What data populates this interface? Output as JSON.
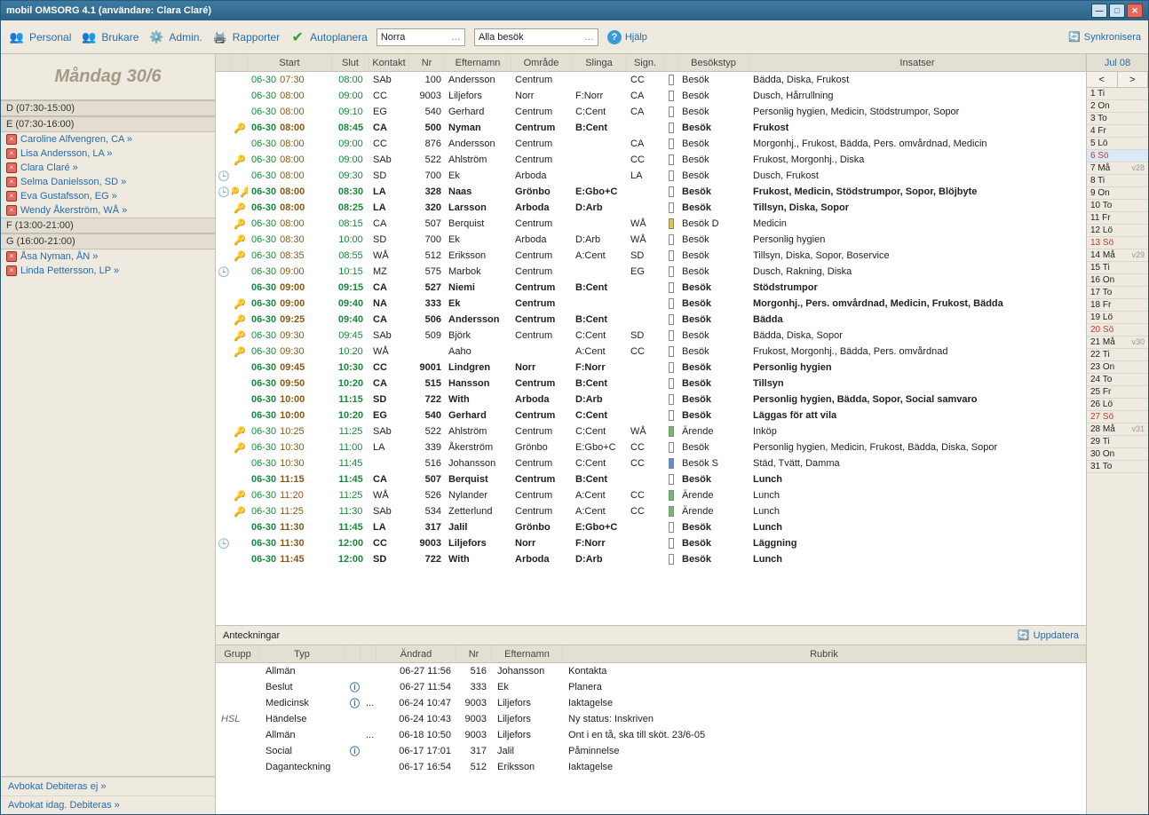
{
  "window": {
    "title": "mobil OMSORG 4.1 (användare: Clara Claré)"
  },
  "toolbar": {
    "personal": "Personal",
    "brukare": "Brukare",
    "admin": "Admin.",
    "rapporter": "Rapporter",
    "autoplanera": "Autoplanera",
    "combo1": "Norra",
    "combo2": "Alla besök",
    "help": "Hjälp",
    "sync": "Synkronisera"
  },
  "sidebar": {
    "day": "Måndag 30/6",
    "groups": [
      {
        "label": "D (07:30-15:00)",
        "staff": []
      },
      {
        "label": "E (07:30-16:00)",
        "staff": [
          "Caroline Alfvengren, CA »",
          "Lisa Andersson, LA »",
          "Clara Claré »",
          "Selma Danielsson, SD »",
          "Eva Gustafsson, EG »",
          "Wendy Åkerström, WÅ »"
        ]
      },
      {
        "label": "F (13:00-21:00)",
        "staff": []
      },
      {
        "label": "G (16:00-21:00)",
        "staff": [
          "Åsa Nyman, ÅN »",
          "Linda  Pettersson, LP »"
        ]
      }
    ],
    "foot1": "Avbokat Debiteras ej »",
    "foot2": "Avbokat idag. Debiteras »"
  },
  "grid": {
    "headers": {
      "start": "Start",
      "slut": "Slut",
      "kontakt": "Kontakt",
      "nr": "Nr",
      "efternamn": "Efternamn",
      "omrade": "Område",
      "slinga": "Slinga",
      "sign": "Sign.",
      "besokstyp": "Besökstyp",
      "insatser": "Insatser"
    },
    "rows": [
      {
        "k": 0,
        "cl": 0,
        "bold": 0,
        "date": "06-30",
        "st": "07:30",
        "sl": "08:00",
        "ko": "SAb",
        "nr": "100",
        "en": "Andersson",
        "om": "Centrum",
        "sli": "",
        "si": "CC",
        "bar": "",
        "ty": "Besök",
        "ins": "Bädda, Diska, Frukost"
      },
      {
        "k": 0,
        "cl": 0,
        "bold": 0,
        "date": "06-30",
        "st": "08:00",
        "sl": "09:00",
        "ko": "CC",
        "nr": "9003",
        "en": "Liljefors",
        "om": "Norr",
        "sli": "F:Norr",
        "si": "CA",
        "bar": "",
        "ty": "Besök",
        "ins": "Dusch, Hårrullning"
      },
      {
        "k": 0,
        "cl": 0,
        "bold": 0,
        "date": "06-30",
        "st": "08:00",
        "sl": "09:10",
        "ko": "EG",
        "nr": "540",
        "en": "Gerhard",
        "om": "Centrum",
        "sli": "C:Cent",
        "si": "CA",
        "bar": "",
        "ty": "Besök",
        "ins": "Personlig hygien, Medicin, Stödstrumpor, Sopor"
      },
      {
        "k": 1,
        "cl": 0,
        "bold": 1,
        "date": "06-30",
        "st": "08:00",
        "sl": "08:45",
        "ko": "CA",
        "nr": "500",
        "en": "Nyman",
        "om": "Centrum",
        "sli": "B:Cent",
        "si": "",
        "bar": "",
        "ty": "Besök",
        "ins": "Frukost"
      },
      {
        "k": 0,
        "cl": 0,
        "bold": 0,
        "date": "06-30",
        "st": "08:00",
        "sl": "09:00",
        "ko": "CC",
        "nr": "876",
        "en": "Andersson",
        "om": "Centrum",
        "sli": "",
        "si": "CA",
        "bar": "",
        "ty": "Besök",
        "ins": "Morgonhj., Frukost, Bädda, Pers. omvårdnad, Medicin"
      },
      {
        "k": 1,
        "cl": 0,
        "bold": 0,
        "date": "06-30",
        "st": "08:00",
        "sl": "09:00",
        "ko": "SAb",
        "nr": "522",
        "en": "Ahlström",
        "om": "Centrum",
        "sli": "",
        "si": "CC",
        "bar": "",
        "ty": "Besök",
        "ins": "Frukost, Morgonhj., Diska"
      },
      {
        "k": 0,
        "cl": 1,
        "bold": 0,
        "date": "06-30",
        "st": "08:00",
        "sl": "09:30",
        "ko": "SD",
        "nr": "700",
        "en": "Ek",
        "om": "Arboda",
        "sli": "",
        "si": "LA",
        "bar": "",
        "ty": "Besök",
        "ins": "Dusch, Frukost"
      },
      {
        "k": 2,
        "cl": 1,
        "bold": 1,
        "date": "06-30",
        "st": "08:00",
        "sl": "08:30",
        "ko": "LA",
        "nr": "328",
        "en": "Naas",
        "om": "Grönbo",
        "sli": "E:Gbo+C",
        "si": "",
        "bar": "",
        "ty": "Besök",
        "ins": "Frukost, Medicin, Stödstrumpor, Sopor, Blöjbyte"
      },
      {
        "k": 1,
        "cl": 0,
        "bold": 1,
        "date": "06-30",
        "st": "08:00",
        "sl": "08:25",
        "ko": "LA",
        "nr": "320",
        "en": "Larsson",
        "om": "Arboda",
        "sli": "D:Arb",
        "si": "",
        "bar": "",
        "ty": "Besök",
        "ins": "Tillsyn, Diska, Sopor"
      },
      {
        "k": 1,
        "cl": 0,
        "bold": 0,
        "date": "06-30",
        "st": "08:00",
        "sl": "08:15",
        "ko": "CA",
        "nr": "507",
        "en": "Berquist",
        "om": "Centrum",
        "sli": "",
        "si": "WÅ",
        "bar": "y",
        "ty": "Besök D",
        "ins": "Medicin"
      },
      {
        "k": 1,
        "cl": 0,
        "bold": 0,
        "date": "06-30",
        "st": "08:30",
        "sl": "10:00",
        "ko": "SD",
        "nr": "700",
        "en": "Ek",
        "om": "Arboda",
        "sli": "D:Arb",
        "si": "WÅ",
        "bar": "",
        "ty": "Besök",
        "ins": "Personlig hygien"
      },
      {
        "k": 1,
        "cl": 0,
        "bold": 0,
        "date": "06-30",
        "st": "08:35",
        "sl": "08:55",
        "ko": "WÅ",
        "nr": "512",
        "en": "Eriksson",
        "om": "Centrum",
        "sli": "A:Cent",
        "si": "SD",
        "bar": "",
        "ty": "Besök",
        "ins": "Tillsyn, Diska, Sopor, Boservice"
      },
      {
        "k": 0,
        "cl": 1,
        "bold": 0,
        "date": "06-30",
        "st": "09:00",
        "sl": "10:15",
        "ko": "MZ",
        "nr": "575",
        "en": "Marbok",
        "om": "Centrum",
        "sli": "",
        "si": "EG",
        "bar": "",
        "ty": "Besök",
        "ins": "Dusch, Rakning, Diska"
      },
      {
        "k": 0,
        "cl": 0,
        "bold": 1,
        "date": "06-30",
        "st": "09:00",
        "sl": "09:15",
        "ko": "CA",
        "nr": "527",
        "en": "Niemi",
        "om": "Centrum",
        "sli": "B:Cent",
        "si": "",
        "bar": "",
        "ty": "Besök",
        "ins": "Stödstrumpor"
      },
      {
        "k": 1,
        "cl": 0,
        "bold": 1,
        "date": "06-30",
        "st": "09:00",
        "sl": "09:40",
        "ko": "NA",
        "nr": "333",
        "en": "Ek",
        "om": "Centrum",
        "sli": "",
        "si": "",
        "bar": "",
        "ty": "Besök",
        "ins": "Morgonhj., Pers. omvårdnad, Medicin, Frukost, Bädda"
      },
      {
        "k": 1,
        "cl": 0,
        "bold": 1,
        "date": "06-30",
        "st": "09:25",
        "sl": "09:40",
        "ko": "CA",
        "nr": "506",
        "en": "Andersson",
        "om": "Centrum",
        "sli": "B:Cent",
        "si": "",
        "bar": "",
        "ty": "Besök",
        "ins": "Bädda"
      },
      {
        "k": 1,
        "cl": 0,
        "bold": 0,
        "date": "06-30",
        "st": "09:30",
        "sl": "09:45",
        "ko": "SAb",
        "nr": "509",
        "en": "Björk",
        "om": "Centrum",
        "sli": "C:Cent",
        "si": "SD",
        "bar": "",
        "ty": "Besök",
        "ins": "Bädda, Diska, Sopor"
      },
      {
        "k": 1,
        "cl": 0,
        "bold": 0,
        "date": "06-30",
        "st": "09:30",
        "sl": "10:20",
        "ko": "WÅ",
        "nr": "",
        "en": "Aaho",
        "om": "",
        "sli": "A:Cent",
        "si": "CC",
        "bar": "",
        "ty": "Besök",
        "ins": "Frukost, Morgonhj., Bädda, Pers. omvårdnad"
      },
      {
        "k": 0,
        "cl": 0,
        "bold": 1,
        "date": "06-30",
        "st": "09:45",
        "sl": "10:30",
        "ko": "CC",
        "nr": "9001",
        "en": "Lindgren",
        "om": "Norr",
        "sli": "F:Norr",
        "si": "",
        "bar": "",
        "ty": "Besök",
        "ins": "Personlig hygien"
      },
      {
        "k": 0,
        "cl": 0,
        "bold": 1,
        "date": "06-30",
        "st": "09:50",
        "sl": "10:20",
        "ko": "CA",
        "nr": "515",
        "en": "Hansson",
        "om": "Centrum",
        "sli": "B:Cent",
        "si": "",
        "bar": "",
        "ty": "Besök",
        "ins": "Tillsyn"
      },
      {
        "k": 0,
        "cl": 0,
        "bold": 1,
        "date": "06-30",
        "st": "10:00",
        "sl": "11:15",
        "ko": "SD",
        "nr": "722",
        "en": "With",
        "om": "Arboda",
        "sli": "D:Arb",
        "si": "",
        "bar": "",
        "ty": "Besök",
        "ins": "Personlig hygien, Bädda, Sopor, Social samvaro"
      },
      {
        "k": 0,
        "cl": 0,
        "bold": 1,
        "date": "06-30",
        "st": "10:00",
        "sl": "10:20",
        "ko": "EG",
        "nr": "540",
        "en": "Gerhard",
        "om": "Centrum",
        "sli": "C:Cent",
        "si": "",
        "bar": "",
        "ty": "Besök",
        "ins": "Läggas för att vila"
      },
      {
        "k": 1,
        "cl": 0,
        "bold": 0,
        "date": "06-30",
        "st": "10:25",
        "sl": "11:25",
        "ko": "SAb",
        "nr": "522",
        "en": "Ahlström",
        "om": "Centrum",
        "sli": "C:Cent",
        "si": "WÅ",
        "bar": "g",
        "ty": "Ärende",
        "ins": "Inköp"
      },
      {
        "k": 1,
        "cl": 0,
        "bold": 0,
        "date": "06-30",
        "st": "10:30",
        "sl": "11:00",
        "ko": "LA",
        "nr": "339",
        "en": "Åkerström",
        "om": "Grönbo",
        "sli": "E:Gbo+C",
        "si": "CC",
        "bar": "",
        "ty": "Besök",
        "ins": "Personlig hygien, Medicin, Frukost, Bädda, Diska, Sopor"
      },
      {
        "k": 0,
        "cl": 0,
        "bold": 0,
        "date": "06-30",
        "st": "10:30",
        "sl": "11:45",
        "ko": "",
        "nr": "516",
        "en": "Johansson",
        "om": "Centrum",
        "sli": "C:Cent",
        "si": "CC",
        "bar": "b",
        "ty": "Besök S",
        "ins": "Städ, Tvätt, Damma"
      },
      {
        "k": 0,
        "cl": 0,
        "bold": 1,
        "date": "06-30",
        "st": "11:15",
        "sl": "11:45",
        "ko": "CA",
        "nr": "507",
        "en": "Berquist",
        "om": "Centrum",
        "sli": "B:Cent",
        "si": "",
        "bar": "",
        "ty": "Besök",
        "ins": "Lunch"
      },
      {
        "k": 1,
        "cl": 0,
        "bold": 0,
        "date": "06-30",
        "st": "11:20",
        "sl": "11:25",
        "ko": "WÅ",
        "nr": "526",
        "en": "Nylander",
        "om": "Centrum",
        "sli": "A:Cent",
        "si": "CC",
        "bar": "g",
        "ty": "Ärende",
        "ins": "Lunch"
      },
      {
        "k": 1,
        "cl": 0,
        "bold": 0,
        "date": "06-30",
        "st": "11:25",
        "sl": "11:30",
        "ko": "SAb",
        "nr": "534",
        "en": "Zetterlund",
        "om": "Centrum",
        "sli": "A:Cent",
        "si": "CC",
        "bar": "g",
        "ty": "Ärende",
        "ins": "Lunch"
      },
      {
        "k": 0,
        "cl": 0,
        "bold": 1,
        "date": "06-30",
        "st": "11:30",
        "sl": "11:45",
        "ko": "LA",
        "nr": "317",
        "en": "Jalil",
        "om": "Grönbo",
        "sli": "E:Gbo+C",
        "si": "",
        "bar": "",
        "ty": "Besök",
        "ins": "Lunch"
      },
      {
        "k": 0,
        "cl": 1,
        "bold": 1,
        "date": "06-30",
        "st": "11:30",
        "sl": "12:00",
        "ko": "CC",
        "nr": "9003",
        "en": "Liljefors",
        "om": "Norr",
        "sli": "F:Norr",
        "si": "",
        "bar": "",
        "ty": "Besök",
        "ins": "Läggning"
      },
      {
        "k": 0,
        "cl": 0,
        "bold": 1,
        "date": "06-30",
        "st": "11:45",
        "sl": "12:00",
        "ko": "SD",
        "nr": "722",
        "en": "With",
        "om": "Arboda",
        "sli": "D:Arb",
        "si": "",
        "bar": "",
        "ty": "Besök",
        "ins": "Lunch"
      }
    ]
  },
  "notes": {
    "label": "Anteckningar",
    "update": "Uppdatera",
    "headers": {
      "grupp": "Grupp",
      "typ": "Typ",
      "andrad": "Ändrad",
      "nr": "Nr",
      "efternamn": "Efternamn",
      "rubrik": "Rubrik"
    },
    "rows": [
      {
        "gr": "",
        "ty": "Allmän",
        "i": 0,
        "d": "",
        "dt": "06-27 11:56",
        "nr": "516",
        "en": "Johansson",
        "ru": "Kontakta"
      },
      {
        "gr": "",
        "ty": "Beslut",
        "i": 1,
        "d": "",
        "dt": "06-27 11:54",
        "nr": "333",
        "en": "Ek",
        "ru": "Planera"
      },
      {
        "gr": "",
        "ty": "Medicinsk",
        "i": 1,
        "d": "...",
        "dt": "06-24 10:47",
        "nr": "9003",
        "en": "Liljefors",
        "ru": "Iaktagelse"
      },
      {
        "gr": "HSL",
        "ty": "Händelse",
        "i": 0,
        "d": "",
        "dt": "06-24 10:43",
        "nr": "9003",
        "en": "Liljefors",
        "ru": "Ny status: Inskriven"
      },
      {
        "gr": "",
        "ty": "Allmän",
        "i": 0,
        "d": "...",
        "dt": "06-18 10:50",
        "nr": "9003",
        "en": "Liljefors",
        "ru": "Ont i en tå, ska till sköt. 23/6-05"
      },
      {
        "gr": "",
        "ty": "Social",
        "i": 1,
        "d": "",
        "dt": "06-17 17:01",
        "nr": "317",
        "en": "Jalil",
        "ru": "Påminnelse"
      },
      {
        "gr": "",
        "ty": "Daganteckning",
        "i": 0,
        "d": "",
        "dt": "06-17 16:54",
        "nr": "512",
        "en": "Eriksson",
        "ru": "Iaktagelse"
      }
    ]
  },
  "cal": {
    "month": "Jul 08",
    "days": [
      {
        "t": "1 Ti"
      },
      {
        "t": "2 On"
      },
      {
        "t": "3 To"
      },
      {
        "t": "4 Fr"
      },
      {
        "t": "5 Lö"
      },
      {
        "t": "6 Sö",
        "s": 1
      },
      {
        "t": "7 Må",
        "wk": "v28"
      },
      {
        "t": "8 Ti"
      },
      {
        "t": "9 On"
      },
      {
        "t": "10 To"
      },
      {
        "t": "11 Fr"
      },
      {
        "t": "12 Lö"
      },
      {
        "t": "13 Sö",
        "s": 1
      },
      {
        "t": "14 Må",
        "wk": "v29"
      },
      {
        "t": "15 Ti"
      },
      {
        "t": "16 On"
      },
      {
        "t": "17 To"
      },
      {
        "t": "18 Fr"
      },
      {
        "t": "19 Lö"
      },
      {
        "t": "20 Sö",
        "s": 1
      },
      {
        "t": "21 Må",
        "wk": "v30"
      },
      {
        "t": "22 Ti"
      },
      {
        "t": "23 On"
      },
      {
        "t": "24 To"
      },
      {
        "t": "25 Fr"
      },
      {
        "t": "26 Lö"
      },
      {
        "t": "27 Sö",
        "s": 1
      },
      {
        "t": "28 Må",
        "wk": "v31"
      },
      {
        "t": "29 Ti"
      },
      {
        "t": "30 On"
      },
      {
        "t": "31 To"
      }
    ]
  }
}
